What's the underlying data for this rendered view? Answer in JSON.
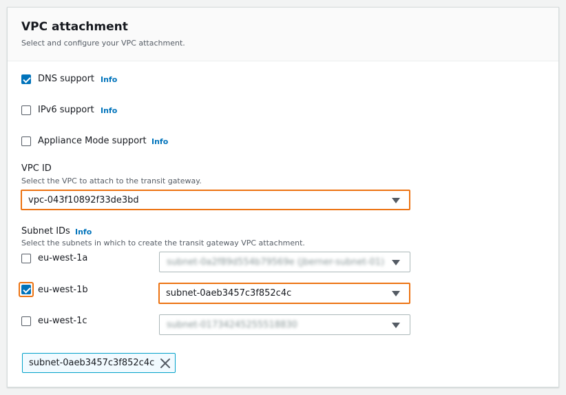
{
  "panel": {
    "title": "VPC attachment",
    "description": "Select and configure your VPC attachment."
  },
  "options": [
    {
      "label": "DNS support",
      "info": "Info",
      "checked": true
    },
    {
      "label": "IPv6 support",
      "info": "Info",
      "checked": false
    },
    {
      "label": "Appliance Mode support",
      "info": "Info",
      "checked": false
    }
  ],
  "vpc": {
    "label": "VPC ID",
    "description": "Select the VPC to attach to the transit gateway.",
    "value": "vpc-043f10892f33de3bd"
  },
  "subnets": {
    "label": "Subnet IDs",
    "info": "Info",
    "description": "Select the subnets in which to create the transit gateway VPC attachment.",
    "rows": [
      {
        "zone": "eu-west-1a",
        "checked": false,
        "value": "subnet-0a2f89d554b79569e (jberner-subnet-01)",
        "obscured": true
      },
      {
        "zone": "eu-west-1b",
        "checked": true,
        "value": "subnet-0aeb3457c3f852c4c",
        "obscured": false
      },
      {
        "zone": "eu-west-1c",
        "checked": false,
        "value": "subnet-01734245255518830",
        "obscured": true
      }
    ]
  },
  "selected_tokens": [
    "subnet-0aeb3457c3f852c4c"
  ],
  "colors": {
    "accent": "#0073bb",
    "focus": "#ec7211",
    "token_border": "#00a1c9"
  }
}
